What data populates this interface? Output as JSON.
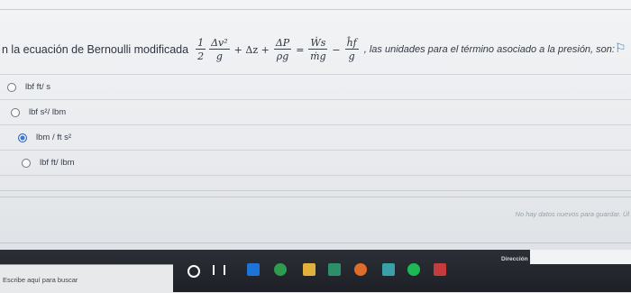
{
  "question": {
    "prefix": "n la ecuación de Bernoulli modificada",
    "suffix": ", las unidades para el término asociado a la presión, son:",
    "equation": {
      "frac1_num": "1",
      "frac1_den": "2",
      "frac2_num": "Δv²",
      "frac2_den": "g",
      "plus1": "+ Δz +",
      "frac3_num": "ΔP",
      "frac3_den": "ρg",
      "equals": "=",
      "frac4_num": "Ẇs",
      "frac4_den": "ṁg",
      "minus": "−",
      "frac5_num": "ĥf",
      "frac5_den": "g"
    }
  },
  "options": [
    {
      "label": "lbf ft/ s",
      "selected": false
    },
    {
      "label": "lbf s²/ lbm",
      "selected": false
    },
    {
      "label": "lbm / ft s²",
      "selected": true
    },
    {
      "label": "lbf ft/ lbm",
      "selected": false
    }
  ],
  "status": {
    "save_text": "No hay datos nuevos para guardar. Úl"
  },
  "taskbar": {
    "search_placeholder": "Escribe aquí para buscar",
    "address_label": "Dirección"
  },
  "colors": {
    "accent": "#3b78d8",
    "taskbar": "#1d2026"
  }
}
